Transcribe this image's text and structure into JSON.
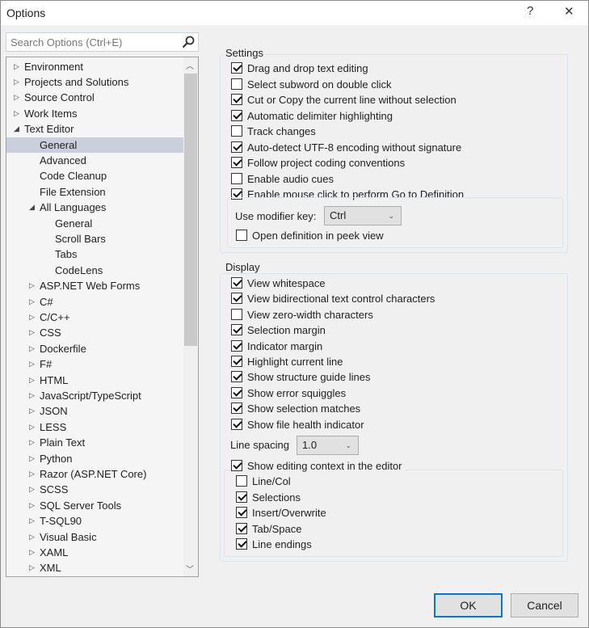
{
  "window": {
    "title": "Options",
    "help": "?",
    "close": "✕"
  },
  "search": {
    "placeholder": "Search Options (Ctrl+E)"
  },
  "tree": [
    {
      "label": "Environment",
      "level": 0,
      "arrow": "collapsed"
    },
    {
      "label": "Projects and Solutions",
      "level": 0,
      "arrow": "collapsed"
    },
    {
      "label": "Source Control",
      "level": 0,
      "arrow": "collapsed"
    },
    {
      "label": "Work Items",
      "level": 0,
      "arrow": "collapsed"
    },
    {
      "label": "Text Editor",
      "level": 0,
      "arrow": "expanded"
    },
    {
      "label": "General",
      "level": 1,
      "arrow": "none",
      "selected": true
    },
    {
      "label": "Advanced",
      "level": 1,
      "arrow": "none"
    },
    {
      "label": "Code Cleanup",
      "level": 1,
      "arrow": "none"
    },
    {
      "label": "File Extension",
      "level": 1,
      "arrow": "none"
    },
    {
      "label": "All Languages",
      "level": 1,
      "arrow": "expanded"
    },
    {
      "label": "General",
      "level": 2,
      "arrow": "none"
    },
    {
      "label": "Scroll Bars",
      "level": 2,
      "arrow": "none"
    },
    {
      "label": "Tabs",
      "level": 2,
      "arrow": "none"
    },
    {
      "label": "CodeLens",
      "level": 2,
      "arrow": "none"
    },
    {
      "label": "ASP.NET Web Forms",
      "level": 1,
      "arrow": "collapsed"
    },
    {
      "label": "C#",
      "level": 1,
      "arrow": "collapsed"
    },
    {
      "label": "C/C++",
      "level": 1,
      "arrow": "collapsed"
    },
    {
      "label": "CSS",
      "level": 1,
      "arrow": "collapsed"
    },
    {
      "label": "Dockerfile",
      "level": 1,
      "arrow": "collapsed"
    },
    {
      "label": "F#",
      "level": 1,
      "arrow": "collapsed"
    },
    {
      "label": "HTML",
      "level": 1,
      "arrow": "collapsed"
    },
    {
      "label": "JavaScript/TypeScript",
      "level": 1,
      "arrow": "collapsed"
    },
    {
      "label": "JSON",
      "level": 1,
      "arrow": "collapsed"
    },
    {
      "label": "LESS",
      "level": 1,
      "arrow": "collapsed"
    },
    {
      "label": "Plain Text",
      "level": 1,
      "arrow": "collapsed"
    },
    {
      "label": "Python",
      "level": 1,
      "arrow": "collapsed"
    },
    {
      "label": "Razor (ASP.NET Core)",
      "level": 1,
      "arrow": "collapsed"
    },
    {
      "label": "SCSS",
      "level": 1,
      "arrow": "collapsed"
    },
    {
      "label": "SQL Server Tools",
      "level": 1,
      "arrow": "collapsed"
    },
    {
      "label": "T-SQL90",
      "level": 1,
      "arrow": "collapsed"
    },
    {
      "label": "Visual Basic",
      "level": 1,
      "arrow": "collapsed"
    },
    {
      "label": "XAML",
      "level": 1,
      "arrow": "collapsed"
    },
    {
      "label": "XML",
      "level": 1,
      "arrow": "collapsed"
    }
  ],
  "settings": {
    "legend": "Settings",
    "items": [
      {
        "label": "Drag and drop text editing",
        "checked": true
      },
      {
        "label": "Select subword on double click",
        "checked": false
      },
      {
        "label": "Cut or Copy the current line without selection",
        "checked": true
      },
      {
        "label": "Automatic delimiter highlighting",
        "checked": true
      },
      {
        "label": "Track changes",
        "checked": false
      },
      {
        "label": "Auto-detect UTF-8 encoding without signature",
        "checked": true
      },
      {
        "label": "Follow project coding conventions",
        "checked": true
      },
      {
        "label": "Enable audio cues",
        "checked": false
      },
      {
        "label": "Enable mouse click to perform Go to Definition",
        "checked": true
      }
    ],
    "modifier_label": "Use modifier key:",
    "modifier_value": "Ctrl",
    "peek": {
      "label": "Open definition in peek view",
      "checked": false
    }
  },
  "display": {
    "legend": "Display",
    "items": [
      {
        "label": "View whitespace",
        "checked": true
      },
      {
        "label": "View bidirectional text control characters",
        "checked": true
      },
      {
        "label": "View zero-width characters",
        "checked": false
      },
      {
        "label": "Selection margin",
        "checked": true
      },
      {
        "label": "Indicator margin",
        "checked": true
      },
      {
        "label": "Highlight current line",
        "checked": true
      },
      {
        "label": "Show structure guide lines",
        "checked": true
      },
      {
        "label": "Show error squiggles",
        "checked": true
      },
      {
        "label": "Show selection matches",
        "checked": true
      },
      {
        "label": "Show file health indicator",
        "checked": true
      }
    ],
    "line_spacing_label": "Line spacing",
    "line_spacing_value": "1.0",
    "context": {
      "label": "Show editing context in the editor",
      "checked": true
    },
    "context_items": [
      {
        "label": "Line/Col",
        "checked": false
      },
      {
        "label": "Selections",
        "checked": true
      },
      {
        "label": "Insert/Overwrite",
        "checked": true
      },
      {
        "label": "Tab/Space",
        "checked": true
      },
      {
        "label": "Line endings",
        "checked": true
      }
    ]
  },
  "buttons": {
    "ok": "OK",
    "cancel": "Cancel"
  }
}
